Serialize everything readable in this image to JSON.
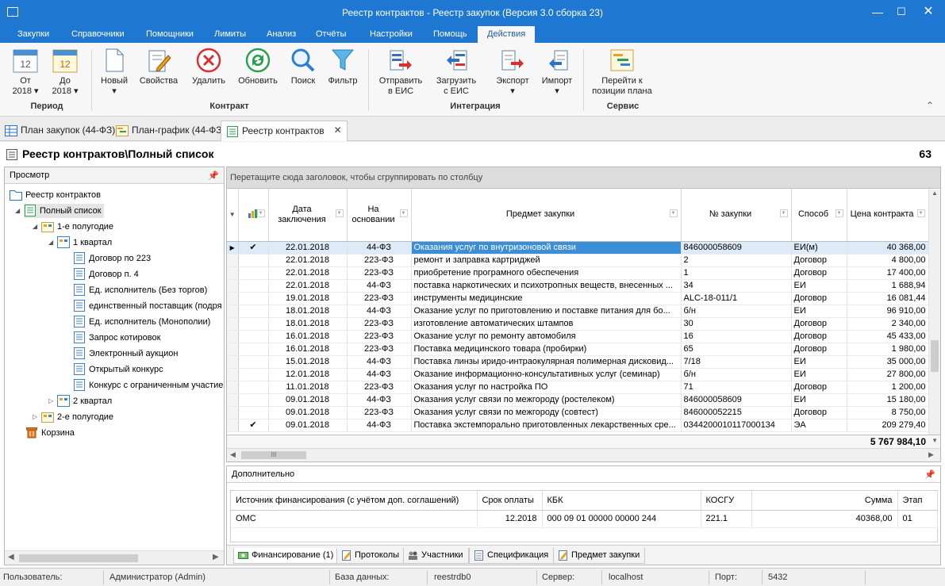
{
  "window": {
    "title": "Реестр контрактов - Реестр закупок (Версия 3.0 сборка 23)"
  },
  "menu": {
    "items": [
      "Закупки",
      "Справочники",
      "Помощники",
      "Лимиты",
      "Анализ",
      "Отчёты",
      "Настройки",
      "Помощь",
      "Действия"
    ],
    "active": "Действия"
  },
  "ribbon": {
    "period": {
      "from_label": "От",
      "from_year": "2018",
      "from_day": "12",
      "to_label": "До",
      "to_year": "2018",
      "to_day": "12",
      "group": "Период"
    },
    "contract": {
      "new": "Новый",
      "props": "Свойства",
      "delete": "Удалить",
      "refresh": "Обновить",
      "search": "Поиск",
      "filter": "Фильтр",
      "group": "Контракт"
    },
    "integration": {
      "send_1": "Отправить",
      "send_2": "в ЕИС",
      "load_1": "Загрузить",
      "load_2": "с ЕИС",
      "export": "Экспорт",
      "import": "Импорт",
      "group": "Интеграция"
    },
    "service": {
      "goto_1": "Перейти к",
      "goto_2": "позиции плана",
      "group": "Сервис"
    }
  },
  "doc_tabs": [
    "План закупок (44-ФЗ)",
    "План-график (44-ФЗ)",
    "Реестр контрактов"
  ],
  "page": {
    "header": "Реестр контрактов\\Полный список",
    "count": "63"
  },
  "tree": {
    "panel_title": "Просмотр",
    "nodes": [
      "Реестр контрактов",
      "Полный список",
      "1-е полугодие",
      "1 квартал",
      "Договор по 223",
      "Договор п. 4",
      "Ед. исполнитель (Без торгов)",
      "единственный поставщик (подря",
      "Ед. исполнитель (Монополии)",
      "Запрос котировок",
      "Электронный аукцион",
      "Открытый конкурс",
      "Конкурс с ограниченным участие",
      "2 квартал",
      "2-е полугодие",
      "Корзина"
    ]
  },
  "grid": {
    "group_hint": "Перетащите сюда заголовок, чтобы сгруппировать по столбцу",
    "headers": {
      "date": "Дата заключения",
      "basis": "На основании",
      "subject": "Предмет закупки",
      "number": "№ закупки",
      "method": "Способ",
      "price": "Цена контракта"
    },
    "rows": [
      {
        "chk": "✔",
        "date": "22.01.2018",
        "basis": "44-ФЗ",
        "subject": "Оказания услуг по внутризоновой связи",
        "number": "846000058609",
        "method": "ЕИ(м)",
        "price": "40 368,00"
      },
      {
        "chk": "",
        "date": "22.01.2018",
        "basis": "223-ФЗ",
        "subject": "ремонт и заправка картриджей",
        "number": "2",
        "method": "Договор",
        "price": "4 800,00"
      },
      {
        "chk": "",
        "date": "22.01.2018",
        "basis": "223-ФЗ",
        "subject": "приобретение програмного обеспечения",
        "number": "1",
        "method": "Договор",
        "price": "17 400,00"
      },
      {
        "chk": "",
        "date": "22.01.2018",
        "basis": "44-ФЗ",
        "subject": "поставка наркотических и психотропных веществ, внесенных ...",
        "number": "34",
        "method": "ЕИ",
        "price": "1 688,94"
      },
      {
        "chk": "",
        "date": "19.01.2018",
        "basis": "223-ФЗ",
        "subject": "инструменты медицинские",
        "number": "ALC-18-011/1",
        "method": "Договор",
        "price": "16 081,44"
      },
      {
        "chk": "",
        "date": "18.01.2018",
        "basis": "44-ФЗ",
        "subject": "Оказание услуг по приготовлению и поставке питания для бо...",
        "number": "б/н",
        "method": "ЕИ",
        "price": "96 910,00"
      },
      {
        "chk": "",
        "date": "18.01.2018",
        "basis": "223-ФЗ",
        "subject": "изготовление автоматических штампов",
        "number": "30",
        "method": "Договор",
        "price": "2 340,00"
      },
      {
        "chk": "",
        "date": "16.01.2018",
        "basis": "223-ФЗ",
        "subject": "Оказание услуг по ремонту автомобиля",
        "number": "16",
        "method": "Договор",
        "price": "45 433,00"
      },
      {
        "chk": "",
        "date": "16.01.2018",
        "basis": "223-ФЗ",
        "subject": "Поставка медицинского товара (пробирки)",
        "number": "65",
        "method": "Договор",
        "price": "1 980,00"
      },
      {
        "chk": "",
        "date": "15.01.2018",
        "basis": "44-ФЗ",
        "subject": "Поставка линзы иридо-интраокулярная полимерная дисковид...",
        "number": "7/18",
        "method": "ЕИ",
        "price": "35 000,00"
      },
      {
        "chk": "",
        "date": "12.01.2018",
        "basis": "44-ФЗ",
        "subject": "Оказание информационно-консультативных услуг (семинар)",
        "number": "б/н",
        "method": "ЕИ",
        "price": "27 800,00"
      },
      {
        "chk": "",
        "date": "11.01.2018",
        "basis": "223-ФЗ",
        "subject": "Оказания услуг по настройка ПО",
        "number": "71",
        "method": "Договор",
        "price": "1 200,00"
      },
      {
        "chk": "",
        "date": "09.01.2018",
        "basis": "44-ФЗ",
        "subject": "Оказания услуг связи по межгороду (ростелеком)",
        "number": "846000058609",
        "method": "ЕИ",
        "price": "15 180,00"
      },
      {
        "chk": "",
        "date": "09.01.2018",
        "basis": "223-ФЗ",
        "subject": "Оказания услуг связи по межгороду  (совтест)",
        "number": "846000052215",
        "method": "Договор",
        "price": "8 750,00"
      },
      {
        "chk": "✔",
        "date": "09.01.2018",
        "basis": "44-ФЗ",
        "subject": "Поставка экстемпорально приготовленных лекарственных сре...",
        "number": "0344200010117000134",
        "method": "ЭА",
        "price": "209 279,40"
      }
    ],
    "total": "5 767 984,10",
    "scroll_label": "III"
  },
  "extra": {
    "title": "Дополнительно",
    "headers": {
      "source": "Источник финансирования (с учётом доп. соглашений)",
      "term": "Срок оплаты",
      "kbk": "КБК",
      "kosgu": "КОСГУ",
      "sum": "Сумма",
      "stage": "Этап"
    },
    "row": {
      "source": "ОМС",
      "term": "12.2018",
      "kbk": "000 09 01 00000 00000 244",
      "kosgu": "221.1",
      "sum": "40368,00",
      "stage": "01"
    },
    "tabs": [
      "Финансирование (1)",
      "Протоколы",
      "Участники",
      "Спецификация",
      "Предмет закупки"
    ]
  },
  "status": {
    "user_label": "Пользователь:",
    "user": "Администратор (Admin)",
    "db_label": "База данных:",
    "db": "reestrdb0",
    "server_label": "Сервер:",
    "server": "localhost",
    "port_label": "Порт:",
    "port": "5432"
  },
  "colors": {
    "titlebar": "#1e78d2",
    "selection": "#3b8fd8"
  }
}
